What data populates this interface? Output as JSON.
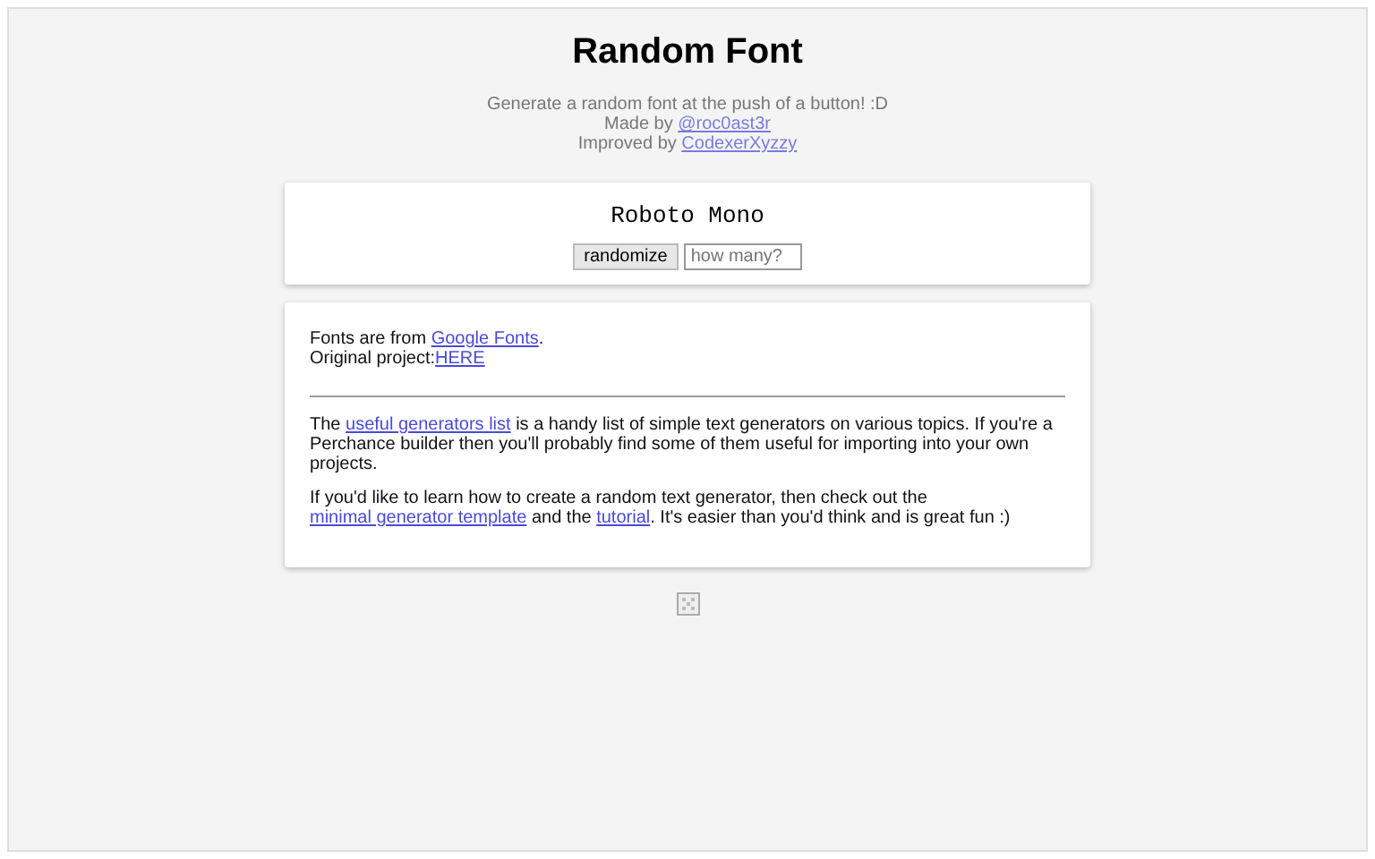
{
  "title": "Random Font",
  "header_lines": [
    [
      {
        "kind": "text",
        "text": "Generate a random font at the push of a button! :D"
      }
    ],
    [
      {
        "kind": "text",
        "text": "Made by "
      },
      {
        "kind": "link",
        "text": "@roc0ast3r"
      }
    ],
    [
      {
        "kind": "text",
        "text": "Improved by "
      },
      {
        "kind": "link",
        "text": "CodexerXyzzy"
      }
    ]
  ],
  "output": {
    "font_name": "Roboto Mono",
    "button": "randomize",
    "count_field": {
      "placeholder": "how many?"
    }
  },
  "info": {
    "lines": [
      [
        {
          "kind": "text",
          "text": "Fonts are from "
        },
        {
          "kind": "link",
          "text": "Google Fonts"
        },
        {
          "kind": "text",
          "text": "."
        }
      ],
      [
        {
          "kind": "text",
          "text": "Original project:"
        },
        {
          "kind": "link",
          "text": "HERE"
        }
      ]
    ],
    "paragraphs": [
      [
        {
          "kind": "text",
          "text": "The "
        },
        {
          "kind": "link",
          "text": "useful generators list"
        },
        {
          "kind": "text",
          "text": " is a handy list of simple text generators on various topics. If you're a Perchance builder then you'll probably find some of them useful for importing into your own projects."
        }
      ],
      [
        {
          "kind": "text",
          "text": "If you'd like to learn how to create a random text generator, then check out the "
        },
        {
          "kind": "link",
          "text": "minimal generator template"
        },
        {
          "kind": "text",
          "text": " and the "
        },
        {
          "kind": "link",
          "text": "tutorial"
        },
        {
          "kind": "text",
          "text": ". It's easier than you'd think and is great fun :)"
        }
      ]
    ]
  }
}
